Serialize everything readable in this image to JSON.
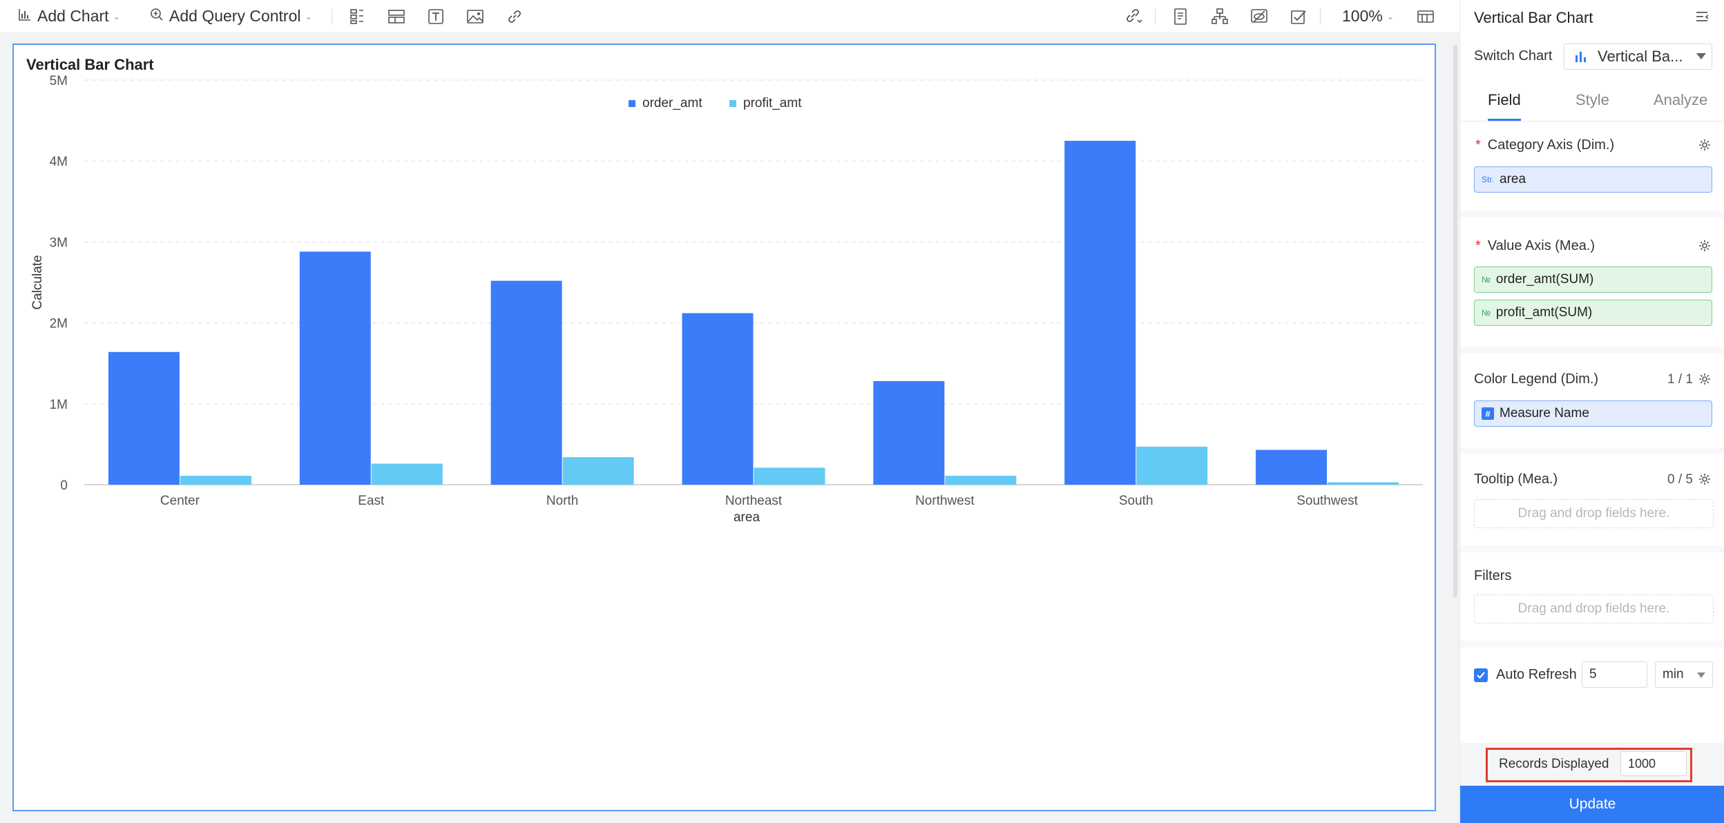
{
  "toolbar": {
    "add_chart_label": "Add Chart",
    "add_query_control_label": "Add Query Control",
    "zoom": "100%"
  },
  "chart_card": {
    "title": "Vertical Bar Chart"
  },
  "chart_data": {
    "type": "bar",
    "title": "Vertical Bar Chart",
    "xlabel": "area",
    "ylabel": "Calculate",
    "categories": [
      "Center",
      "East",
      "North",
      "Northeast",
      "Northwest",
      "South",
      "Southwest"
    ],
    "series": [
      {
        "name": "order_amt",
        "color": "#3b7cf8",
        "values": [
          1640000,
          2880000,
          2520000,
          2120000,
          1280000,
          4250000,
          430000
        ]
      },
      {
        "name": "profit_amt",
        "color": "#63c9f5",
        "values": [
          110000,
          260000,
          340000,
          210000,
          110000,
          470000,
          30000
        ]
      }
    ],
    "ylim": [
      0,
      5000000
    ],
    "yticks": [
      {
        "value": 0,
        "label": "0"
      },
      {
        "value": 1000000,
        "label": "1M"
      },
      {
        "value": 2000000,
        "label": "2M"
      },
      {
        "value": 3000000,
        "label": "3M"
      },
      {
        "value": 4000000,
        "label": "4M"
      },
      {
        "value": 5000000,
        "label": "5M"
      }
    ],
    "grid": true,
    "legend_position": "top-center"
  },
  "panel": {
    "title": "Vertical Bar Chart",
    "switch_chart_label": "Switch Chart",
    "switch_chart_value": "Vertical Ba...",
    "tabs": [
      {
        "label": "Field",
        "active": true
      },
      {
        "label": "Style",
        "active": false
      },
      {
        "label": "Analyze",
        "active": false
      }
    ],
    "category_axis": {
      "label": "Category Axis (Dim.)",
      "field_tag": "Str.",
      "field": "area"
    },
    "value_axis": {
      "label": "Value Axis (Mea.)",
      "fields": [
        {
          "tag": "№",
          "name": "order_amt(SUM)"
        },
        {
          "tag": "№",
          "name": "profit_amt(SUM)"
        }
      ]
    },
    "color_legend": {
      "label": "Color Legend (Dim.)",
      "count": "1 / 1",
      "field": "Measure Name"
    },
    "tooltip": {
      "label": "Tooltip (Mea.)",
      "count": "0 / 5",
      "placeholder": "Drag and drop fields here."
    },
    "filters": {
      "label": "Filters",
      "placeholder": "Drag and drop fields here."
    },
    "auto_refresh": {
      "label": "Auto Refresh",
      "checked": true,
      "value": "5",
      "unit": "min"
    },
    "records": {
      "label": "Records Displayed",
      "value": "1000"
    },
    "update_label": "Update"
  }
}
